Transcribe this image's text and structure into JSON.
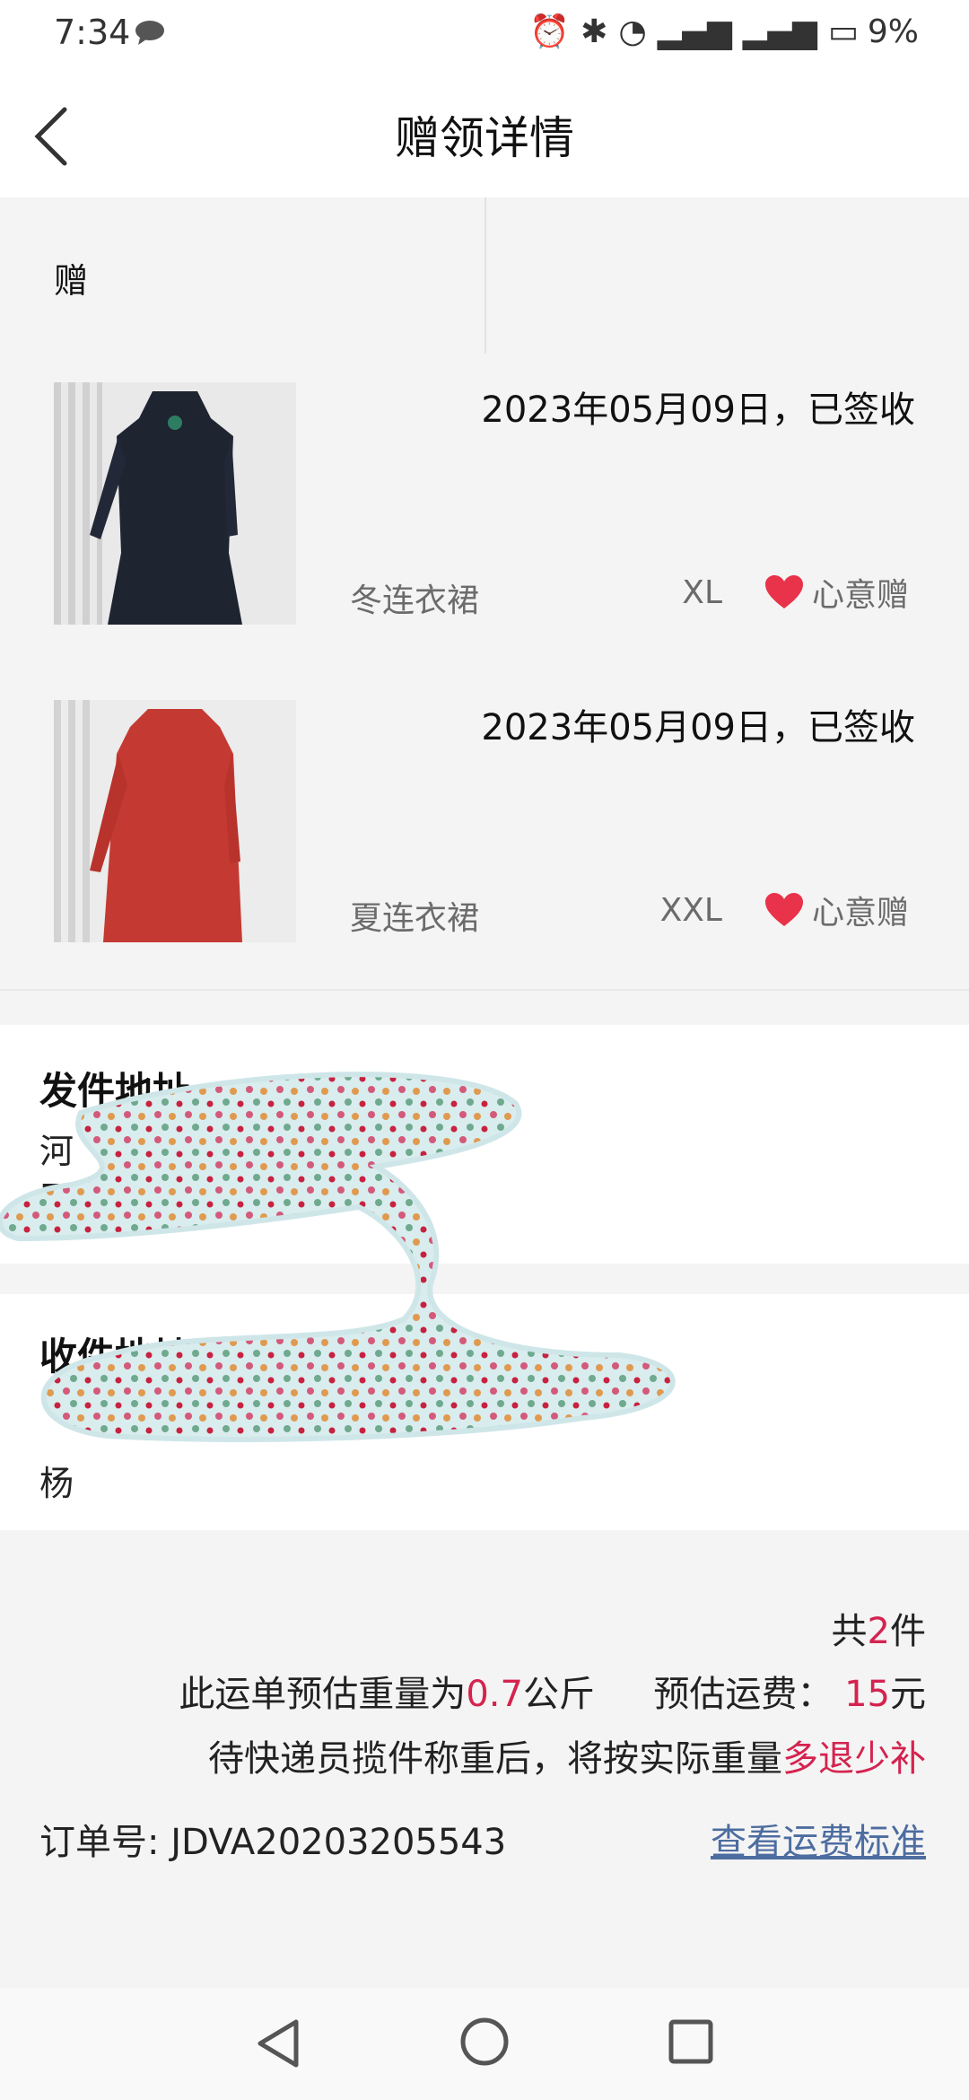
{
  "status": {
    "time": "7:34",
    "battery": "9%"
  },
  "header": {
    "title": "赠领详情"
  },
  "tabs": {
    "give_label": "赠"
  },
  "items": [
    {
      "date_status": "2023年05月09日，已签收",
      "name": "冬连衣裙",
      "size": "XL",
      "tag": "心意赠",
      "image": "dark dress photo"
    },
    {
      "date_status": "2023年05月09日，已签收",
      "name": "夏连衣裙",
      "size": "XXL",
      "tag": "心意赠",
      "image": "red dress photo"
    }
  ],
  "sender": {
    "title": "发件地址",
    "line1": "河",
    "line2": "E"
  },
  "receiver": {
    "title": "收件地址",
    "line3": "杨"
  },
  "summary": {
    "total_prefix": "共",
    "total_count": "2",
    "total_suffix": "件",
    "weight_prefix": "此运单预估重量为",
    "weight_value": "0.7",
    "weight_unit": "公斤",
    "fee_label": "预估运费：",
    "fee_value": "15",
    "fee_unit": "元",
    "note_text": "待快递员揽件称重后，将按实际重量",
    "note_highlight": "多退少补",
    "order_label": "订单号:",
    "order_number": "JDVA20203205543",
    "fee_link": "查看运费标准"
  },
  "colors": {
    "accent_red": "#d4234f",
    "link_blue": "#4d6da0",
    "heart_red": "#e8334a"
  }
}
